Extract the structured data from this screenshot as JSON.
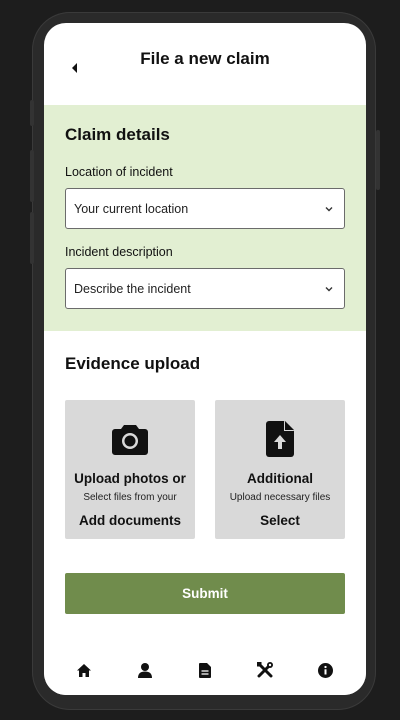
{
  "header": {
    "title": "File a new claim",
    "back_icon": "chevron-left-icon"
  },
  "claim_details": {
    "title": "Claim details",
    "background": "#e2efd2",
    "location": {
      "label": "Location of incident",
      "value": "Your current location"
    },
    "description": {
      "label": "Incident description",
      "value": "Describe the incident"
    }
  },
  "evidence": {
    "title": "Evidence upload",
    "cards": [
      {
        "icon": "camera-icon",
        "title": "Upload photos or",
        "subtitle": "Select files from your",
        "action": "Add documents"
      },
      {
        "icon": "file-upload-icon",
        "title": "Additional",
        "subtitle": "Upload necessary files",
        "action": "Select"
      }
    ]
  },
  "submit": {
    "label": "Submit",
    "color": "#708c4c"
  },
  "tabbar": {
    "icons": [
      "home-icon",
      "person-icon",
      "document-icon",
      "tools-icon",
      "info-icon"
    ]
  }
}
